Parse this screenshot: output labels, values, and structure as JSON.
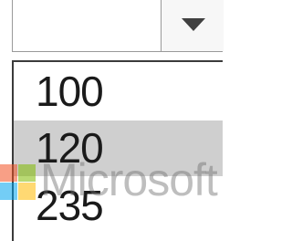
{
  "combo": {
    "value": "",
    "arrow_icon": "chevron-down-icon"
  },
  "dropdown": {
    "options": [
      "100",
      "120",
      "235"
    ],
    "highlighted_index": 1
  },
  "watermark": {
    "text": "Microsoft",
    "logo_colors": [
      "#f25022",
      "#7fba00",
      "#00a4ef",
      "#ffb900"
    ]
  },
  "colors": {
    "highlight": "#cfcfcf",
    "border": "#9a9a9a"
  }
}
